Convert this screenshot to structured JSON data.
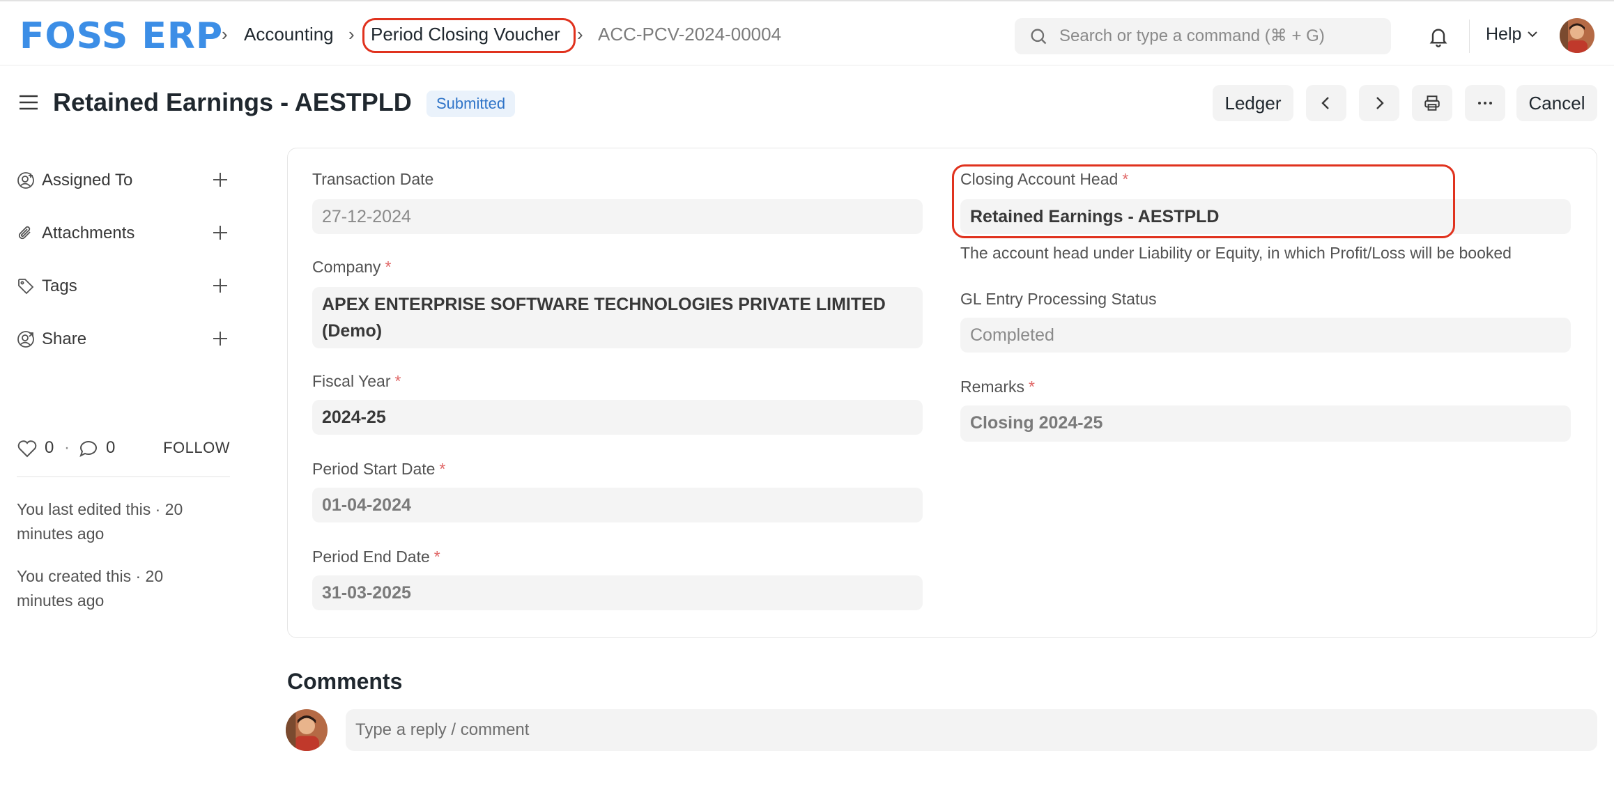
{
  "navbar": {
    "brand": "FOSS ERP",
    "breadcrumbs": [
      "Accounting",
      "Period Closing Voucher",
      "ACC-PCV-2024-00004"
    ],
    "search_placeholder": "Search or type a command (⌘ + G)",
    "help_label": "Help"
  },
  "page": {
    "title": "Retained Earnings - AESTPLD",
    "status": "Submitted",
    "status_color": "#2f74c8"
  },
  "actions": {
    "ledger_label": "Ledger",
    "cancel_label": "Cancel"
  },
  "sidebar": {
    "items": [
      {
        "label": "Assigned To",
        "icon": "user-plus-icon"
      },
      {
        "label": "Attachments",
        "icon": "paperclip-icon"
      },
      {
        "label": "Tags",
        "icon": "tag-icon"
      },
      {
        "label": "Share",
        "icon": "share-user-icon"
      }
    ],
    "likes": "0",
    "dot": "·",
    "comments_count": "0",
    "follow_label": "FOLLOW",
    "activity": [
      "You last edited this · 20 minutes ago",
      "You created this · 20 minutes ago"
    ]
  },
  "form": {
    "transaction_date": {
      "label": "Transaction Date",
      "value": "27-12-2024"
    },
    "company": {
      "label": "Company",
      "required": "*",
      "value": "APEX ENTERPRISE SOFTWARE TECHNOLOGIES PRIVATE LIMITED (Demo)"
    },
    "fiscal_year": {
      "label": "Fiscal Year",
      "required": "*",
      "value": "2024-25"
    },
    "period_start_date": {
      "label": "Period Start Date",
      "required": "*",
      "value": "01-04-2024"
    },
    "period_end_date": {
      "label": "Period End Date",
      "required": "*",
      "value": "31-03-2025"
    },
    "closing_account_head": {
      "label": "Closing Account Head",
      "required": "*",
      "value": "Retained Earnings - AESTPLD",
      "description": "The account head under Liability or Equity, in which Profit/Loss will be booked"
    },
    "gl_status": {
      "label": "GL Entry Processing Status",
      "value": "Completed"
    },
    "remarks": {
      "label": "Remarks",
      "required": "*",
      "value": "Closing 2024-25"
    }
  },
  "comments": {
    "title": "Comments",
    "placeholder": "Type a reply / comment"
  },
  "colors": {
    "brand": "#3c8ee6",
    "highlight": "#e0321e",
    "required": "#e06666"
  }
}
